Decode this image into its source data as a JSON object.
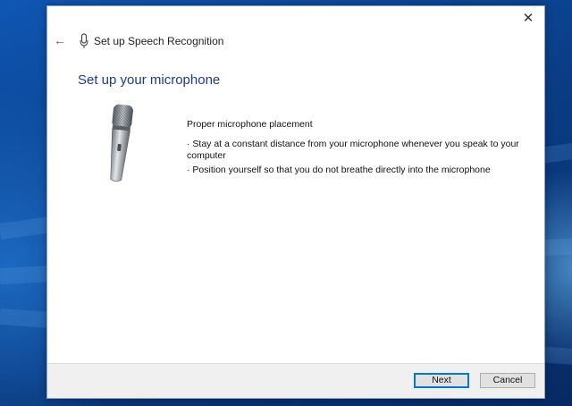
{
  "window": {
    "title": "Set up Speech Recognition",
    "close_glyph": "✕",
    "back_glyph": "←"
  },
  "page": {
    "heading": "Set up your microphone",
    "subheading": "Proper microphone placement",
    "bullets": [
      "· Stay at a constant distance from your microphone whenever you speak to your computer",
      "· Position yourself so that you do not breathe directly into the microphone"
    ]
  },
  "footer": {
    "next_label": "Next",
    "cancel_label": "Cancel"
  },
  "colors": {
    "heading": "#1e3a8a",
    "primary_border": "#0078d7",
    "desktop": "#0a3d86"
  },
  "icons": {
    "back": "back-arrow-icon",
    "header": "microphone-icon",
    "close": "close-icon"
  }
}
